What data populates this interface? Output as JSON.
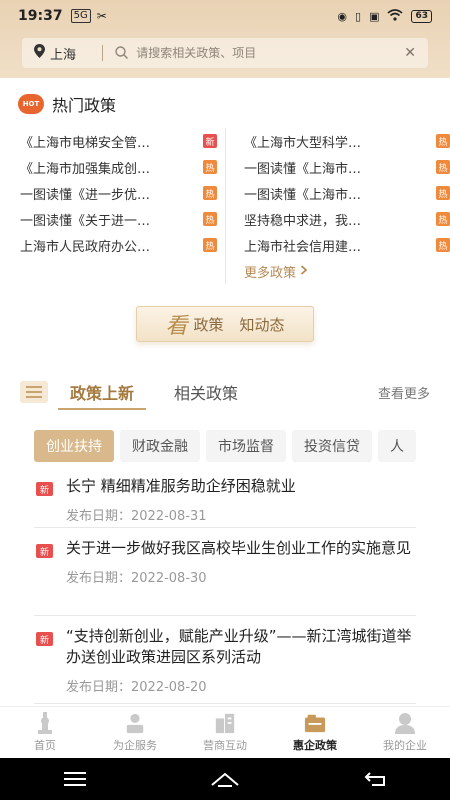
{
  "status": {
    "time": "19:37",
    "badge1": "5G",
    "battery": "63"
  },
  "search": {
    "location": "上海",
    "placeholder": "请搜索相关政策、项目"
  },
  "hot": {
    "badge": "HOT",
    "title": "热门政策",
    "left": [
      {
        "text": "《上海市电梯安全管…",
        "tag": "新",
        "type": "new"
      },
      {
        "text": "《上海市加强集成创…",
        "tag": "热",
        "type": "hot"
      },
      {
        "text": "一图读懂《进一步优…",
        "tag": "热",
        "type": "hot"
      },
      {
        "text": "一图读懂《关于进一…",
        "tag": "热",
        "type": "hot"
      },
      {
        "text": "上海市人民政府办公…",
        "tag": "热",
        "type": "hot"
      }
    ],
    "right": [
      {
        "text": "《上海市大型科学…",
        "tag": "热",
        "type": "hot"
      },
      {
        "text": "一图读懂《上海市…",
        "tag": "热",
        "type": "hot"
      },
      {
        "text": "一图读懂《上海市…",
        "tag": "热",
        "type": "hot"
      },
      {
        "text": "坚持稳中求进，我…",
        "tag": "热",
        "type": "hot"
      },
      {
        "text": "上海市社会信用建…",
        "tag": "热",
        "type": "hot"
      }
    ],
    "more": "更多政策"
  },
  "banner": {
    "kan": "看",
    "part1": "政策",
    "part2": "知动态"
  },
  "tabs": {
    "active": "政策上新",
    "inactive": "相关政策",
    "see_more": "查看更多"
  },
  "chips": [
    "创业扶持",
    "财政金融",
    "市场监督",
    "投资信贷",
    "人"
  ],
  "news": [
    {
      "tag": "新",
      "title": "长宁 精细精准服务助企纾困稳就业",
      "date": "发布日期：2022-08-31"
    },
    {
      "tag": "新",
      "title": "关于进一步做好我区高校毕业生创业工作的实施意见",
      "date": "发布日期：2022-08-30"
    },
    {
      "tag": "新",
      "title": "“支持创新创业，赋能产业升级”——新江湾城街道举办送创业政策进园区系列活动",
      "date": "发布日期：2022-08-20"
    }
  ],
  "nav": [
    {
      "label": "首页",
      "icon": "home-tower-icon"
    },
    {
      "label": "为企服务",
      "icon": "service-person-icon"
    },
    {
      "label": "营商互动",
      "icon": "building-icon"
    },
    {
      "label": "惠企政策",
      "icon": "policy-folder-icon"
    },
    {
      "label": "我的企业",
      "icon": "user-icon"
    }
  ],
  "colors": {
    "accent": "#c8a46e",
    "header": "#e9d2b4",
    "new_tag": "#e84f4f",
    "hot_tag": "#ef8a3c"
  }
}
